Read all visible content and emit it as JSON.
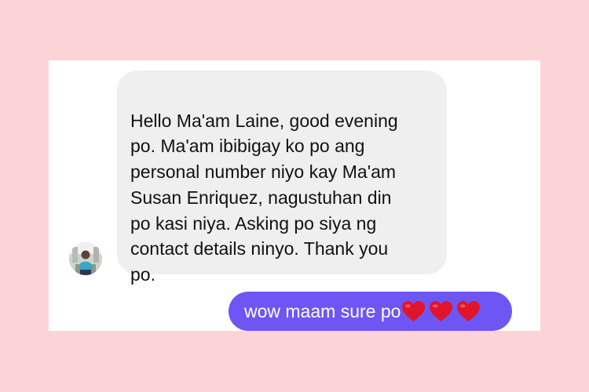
{
  "conversation": {
    "incoming_message": "Hello Ma'am Laine, good evening\npo. Ma'am ibibigay ko po ang\npersonal number niyo kay Ma'am\nSusan Enriquez, nagustuhan din\npo kasi niya. Asking po siya ng\ncontact details ninyo. Thank you\npo.",
    "outgoing_message": "wow maam sure po",
    "outgoing_emoji": [
      "red-heart",
      "red-heart",
      "red-heart"
    ]
  },
  "colors": {
    "page_background": "#fcd4d8",
    "incoming_bubble": "#efefef",
    "outgoing_bubble": "#6d56f4",
    "heart": "#e0152b"
  },
  "icons": {
    "sender_avatar": "profile-photo",
    "emoji": "red-heart-icon"
  }
}
